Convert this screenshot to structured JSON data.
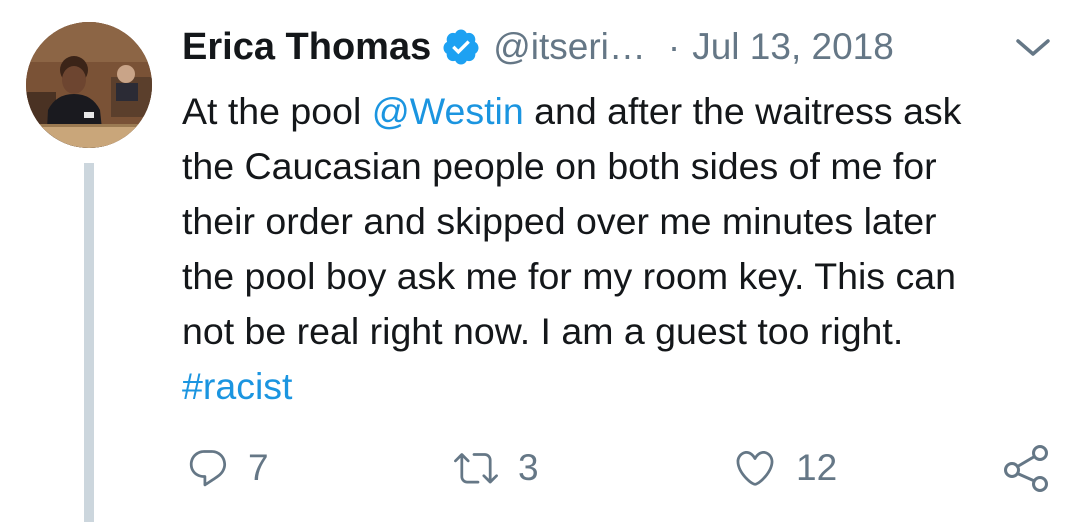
{
  "tweet": {
    "author_name": "Erica Thomas",
    "handle": "@itseri…",
    "separator": "·",
    "date": "Jul 13, 2018",
    "body": {
      "line1_pre": "At the pool ",
      "mention": "@Westin",
      "line1_post": " and after the waitress ask",
      "line2": "the Caucasian people on both sides of me for",
      "line3": "their order and skipped over me minutes later",
      "line4": "the pool boy ask me for my room key. This can",
      "line5": "not be real right now. I am a guest too right.",
      "hashtag": "#racist"
    },
    "actions": {
      "replies": "7",
      "retweets": "3",
      "likes": "12"
    }
  },
  "colors": {
    "text": "#14171a",
    "secondary": "#657786",
    "link": "#1b95e0",
    "verified": "#1da1f2",
    "thread_line": "#ccd6dd"
  },
  "icons": [
    "verified-badge-icon",
    "chevron-down-icon",
    "reply-icon",
    "retweet-icon",
    "like-heart-icon",
    "share-icon"
  ]
}
